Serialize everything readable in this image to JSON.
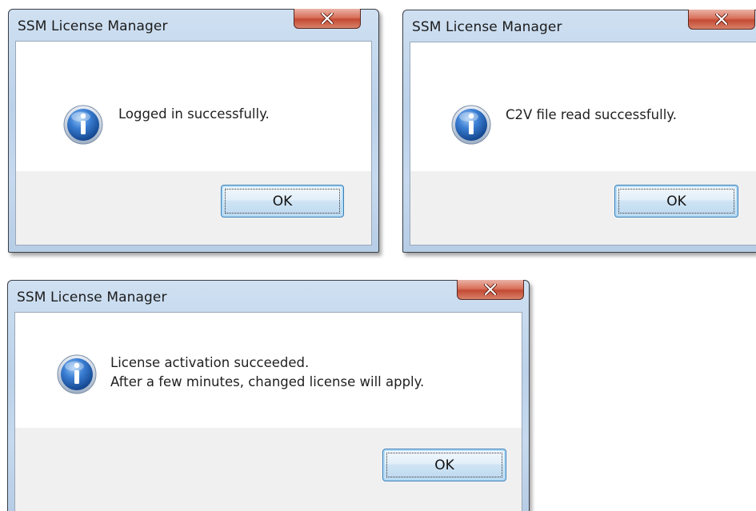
{
  "dialogs": [
    {
      "title": "SSM License Manager",
      "message_lines": [
        "Logged in successfully."
      ],
      "ok_label": "OK",
      "close_glyph": "x",
      "icon": "info-icon"
    },
    {
      "title": "SSM License Manager",
      "message_lines": [
        "C2V file read successfully."
      ],
      "ok_label": "OK",
      "close_glyph": "x",
      "icon": "info-icon"
    },
    {
      "title": "SSM License Manager",
      "message_lines": [
        "License activation succeeded.",
        "After a few minutes, changed license will apply."
      ],
      "ok_label": "OK",
      "close_glyph": "x",
      "icon": "info-icon"
    }
  ],
  "colors": {
    "titlebar": "#c6d9ee",
    "close_button": "#c44a33",
    "client_background": "#ffffff",
    "footer_background": "#f0f0f0",
    "ok_button_border": "#3a7fb8",
    "info_icon_blue": "#1f5fb3"
  }
}
